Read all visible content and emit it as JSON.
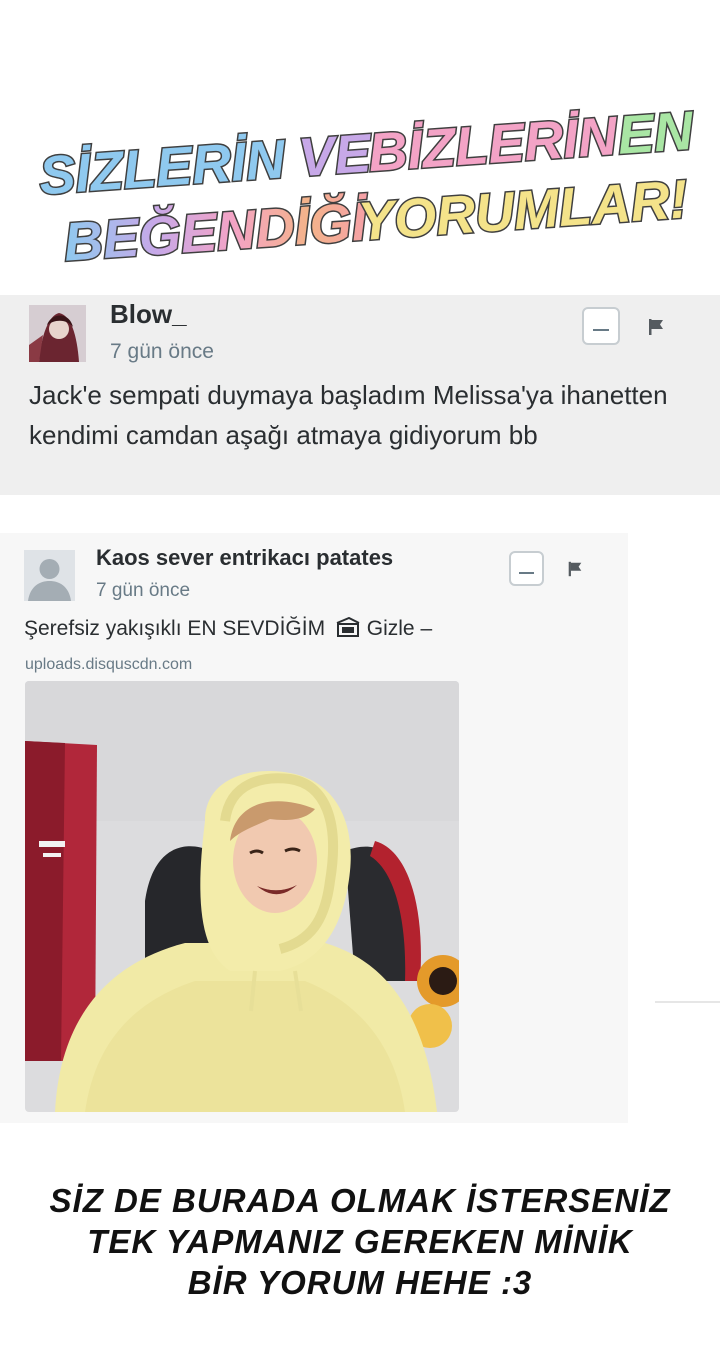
{
  "header": {
    "title_line1_part1": "SİZLERİN",
    "title_line1_part2": "VE",
    "title_line1_part3": "BİZLERİN",
    "title_line1_part4": "EN",
    "title_line2_part1": "BEĞENDİĞİ",
    "title_line2_part2": "YORUMLAR!"
  },
  "comments": [
    {
      "author": "Blow_",
      "time": "7 gün önce",
      "text": "Jack'e sempati duymaya başladım Melissa'ya ihanetten kendimi camdan aşağı atmaya gidiyorum bb",
      "collapse_icon": "minus-icon",
      "flag_icon": "flag-icon"
    },
    {
      "author": "Kaos sever entrikacı patates",
      "time": "7 gün önce",
      "text": "Şerefsiz yakışıklı EN SEVDİĞİM",
      "hide_label": "Gizle",
      "hide_dash": "–",
      "media_source": "uploads.disquscdn.com",
      "media_icon": "image-icon",
      "collapse_icon": "minus-icon",
      "flag_icon": "flag-icon"
    }
  ],
  "footer": {
    "line1": "SİZ DE BURADA OLMAK İSTERSENİZ",
    "line2": "TEK YAPMANIZ GEREKEN MİNİK",
    "line3": "BİR YORUM HEHE  :3"
  },
  "colors": {
    "title_blue": "#8fc9ef",
    "title_purple": "#c7a8e8",
    "title_pink": "#f3a3c6",
    "title_yellow": "#f4e38a",
    "title_green": "#a9e6a4",
    "title_outline": "#3f3f3f",
    "card_bg": "#efefef",
    "text": "#2a2e31",
    "muted": "#687a86"
  }
}
